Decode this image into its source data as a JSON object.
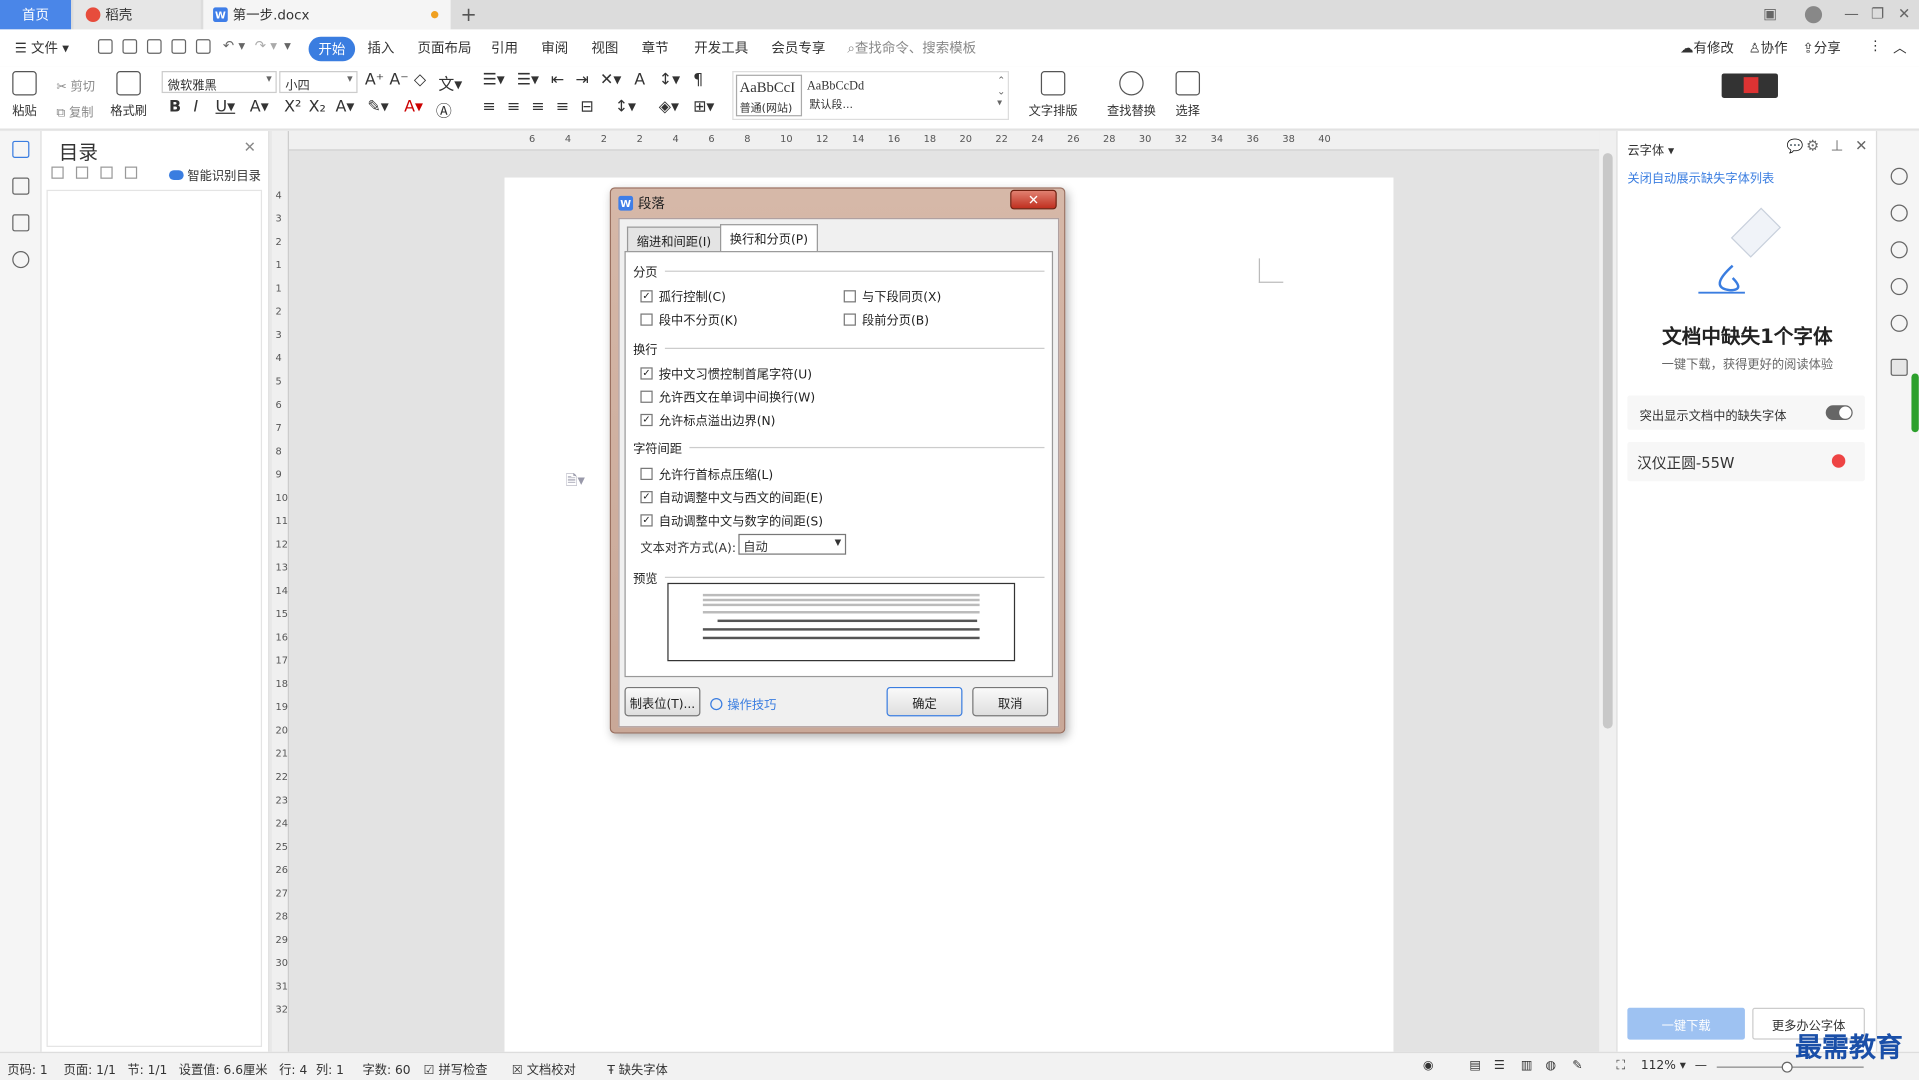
{
  "window": {
    "tabs": [
      {
        "label": "首页"
      },
      {
        "label": "稻壳"
      },
      {
        "label": "第一步.docx"
      }
    ],
    "new_tab": "+"
  },
  "menu": {
    "file": "文件",
    "items": [
      "开始",
      "插入",
      "页面布局",
      "引用",
      "审阅",
      "视图",
      "章节",
      "开发工具",
      "会员专享"
    ],
    "search_placeholder": "查找命令、搜索模板",
    "right": [
      "有修改",
      "协作",
      "分享"
    ]
  },
  "ribbon": {
    "paste": "粘贴",
    "cut": "剪切",
    "copy": "复制",
    "format_painter": "格式刷",
    "font_name": "微软雅黑",
    "font_size": "小四",
    "style1_sample": "AaBbCcI",
    "style1_name": "普通(网站)",
    "style2_sample": "AaBbCcDd",
    "style2_name": "默认段...",
    "text_layout": "文字排版",
    "find_replace": "查找替换",
    "select": "选择"
  },
  "toc": {
    "title": "目录",
    "smart": "智能识别目录"
  },
  "ruler": {
    "h": [
      "6",
      "4",
      "2",
      "2",
      "4",
      "6",
      "8",
      "10",
      "12",
      "14",
      "16",
      "18",
      "20",
      "22",
      "24",
      "26",
      "28",
      "30",
      "32",
      "34",
      "36",
      "38",
      "40"
    ],
    "v": [
      "4",
      "3",
      "2",
      "1",
      "1",
      "2",
      "3",
      "4",
      "5",
      "6",
      "7",
      "8",
      "9",
      "10",
      "11",
      "12",
      "13",
      "14",
      "15",
      "16",
      "17",
      "18",
      "19",
      "20",
      "21",
      "22",
      "23",
      "24",
      "25",
      "26",
      "27",
      "28",
      "29",
      "30",
      "31",
      "32"
    ]
  },
  "dialog": {
    "title": "段落",
    "tabs": [
      "缩进和间距(I)",
      "换行和分页(P)"
    ],
    "sections": {
      "paging": "分页",
      "line_break": "换行",
      "char_spacing": "字符间距",
      "preview": "预览"
    },
    "checks": {
      "widow": "孤行控制(C)",
      "keep_next": "与下段同页(X)",
      "keep_lines": "段中不分页(K)",
      "page_before": "段前分页(B)",
      "cn_rules": "按中文习惯控制首尾字符(U)",
      "allow_word_break": "允许西文在单词中间换行(W)",
      "punct_overflow": "允许标点溢出边界(N)",
      "compress_punct": "允许行首标点压缩(L)",
      "auto_cn_en": "自动调整中文与西文的间距(E)",
      "auto_cn_num": "自动调整中文与数字的间距(S)"
    },
    "checked": {
      "widow": true,
      "keep_next": false,
      "keep_lines": false,
      "page_before": false,
      "cn_rules": true,
      "allow_word_break": false,
      "punct_overflow": true,
      "compress_punct": false,
      "auto_cn_en": true,
      "auto_cn_num": true
    },
    "align_label": "文本对齐方式(A):",
    "align_value": "自动",
    "tabs_button": "制表位(T)...",
    "tips": "操作技巧",
    "ok": "确定",
    "cancel": "取消"
  },
  "right_panel": {
    "header": "云字体",
    "close_link": "关闭自动展示缺失字体列表",
    "headline": "文档中缺失1个字体",
    "sub": "一键下载，获得更好的阅读体验",
    "toggle_label": "突出显示文档中的缺失字体",
    "font_item": "汉仪正圆-55W",
    "download": "一键下载",
    "more": "更多办公字体"
  },
  "status": {
    "page_code": "页码: 1",
    "page": "页面: 1/1",
    "section": "节: 1/1",
    "setting": "设置值: 6.6厘米",
    "row": "行: 4",
    "col": "列: 1",
    "words": "字数: 60",
    "spell": "拼写检查",
    "proof": "文档校对",
    "missing_font": "缺失字体",
    "zoom": "112%"
  },
  "watermark": "最需教育",
  "colors": {
    "accent": "#3a7de0",
    "tab_home": "#4a86e8"
  }
}
